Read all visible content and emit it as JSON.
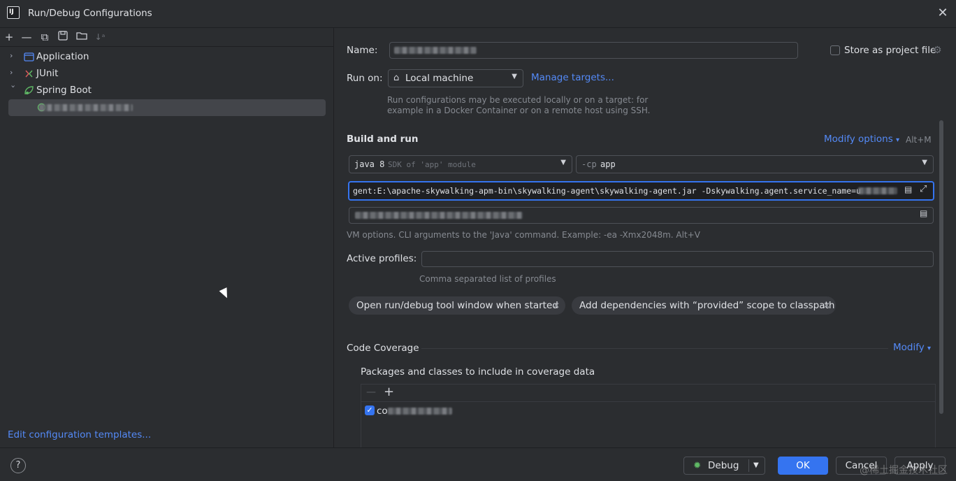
{
  "window": {
    "title": "Run/Debug Configurations"
  },
  "tree": {
    "items": [
      {
        "label": "Application"
      },
      {
        "label": "JUnit"
      },
      {
        "label": "Spring Boot"
      }
    ]
  },
  "left": {
    "edit_templates": "Edit configuration templates..."
  },
  "form": {
    "name_label": "Name:",
    "store_label": "Store as project file",
    "runon_label": "Run on:",
    "runon_value": "Local machine",
    "manage_targets": "Manage targets...",
    "runon_hint_1": "Run configurations may be executed locally or on a target: for",
    "runon_hint_2": "example in a Docker Container or on a remote host using SSH.",
    "build_run": "Build and run",
    "modify_options": "Modify options",
    "modify_shortcut": "Alt+M",
    "jdk_value": "java 8",
    "jdk_hint": "SDK of 'app' module",
    "cp_prefix": "-cp",
    "cp_value": "app",
    "vm_options": "gent:E:\\apache-skywalking-apm-bin\\skywalking-agent\\skywalking-agent.jar -Dskywalking.agent.service_name=u",
    "vm_hint": "VM options. CLI arguments to the 'Java' command. Example: -ea -Xmx2048m. Alt+V",
    "profiles_label": "Active profiles:",
    "profiles_hint": "Comma separated list of profiles",
    "chip1": "Open run/debug tool window when started",
    "chip2": "Add dependencies with “provided” scope to classpath",
    "coverage_title": "Code Coverage",
    "coverage_modify": "Modify",
    "coverage_packages": "Packages and classes to include in coverage data",
    "coverage_item_prefix": "co"
  },
  "buttons": {
    "help": "?",
    "debug": "Debug",
    "ok": "OK",
    "cancel": "Cancel",
    "apply": "Apply"
  },
  "watermark": "@稀土掘金技术社区",
  "colors": {
    "accent": "#3574f0",
    "link": "#548af7",
    "bg": "#2b2d30"
  }
}
